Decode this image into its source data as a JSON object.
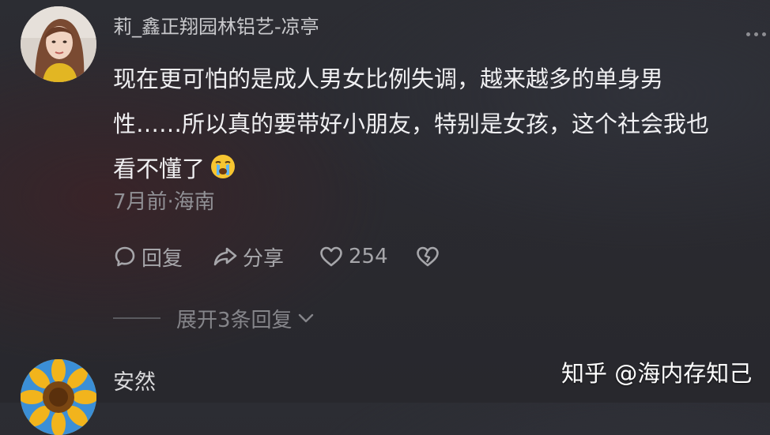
{
  "comment1": {
    "username": "莉_鑫正翔园林铝艺-凉亭",
    "lines": [
      "现在更可怕的是成人男女比例失调，越来越多的单身男",
      "性……所以真的要带好小朋友，特别是女孩，这个社会我也",
      "看不懂了"
    ],
    "emoji": "crying-face-emoji",
    "meta": "7月前·海南",
    "actions": {
      "reply_label": "回复",
      "share_label": "分享",
      "like_count": "254"
    },
    "expand_label": "展开3条回复"
  },
  "comment2": {
    "username": "安然"
  },
  "watermark": "知乎 @海内存知己",
  "colors": {
    "background": "#2a2a30",
    "text_primary": "#f0f0f2",
    "text_secondary": "#909095",
    "icon": "#a6a6aa"
  }
}
